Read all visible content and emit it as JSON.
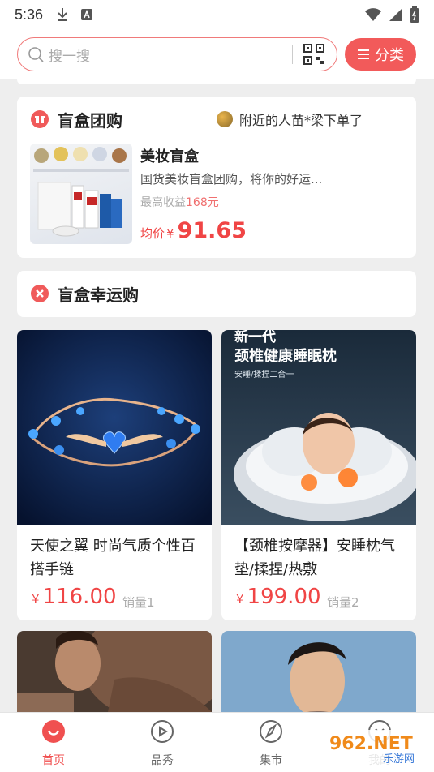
{
  "status_bar": {
    "time": "5:36"
  },
  "search": {
    "placeholder": "搜一搜"
  },
  "category_button": {
    "label": "分类"
  },
  "group_buy": {
    "title": "盲盒团购",
    "notice": "附近的人苗*梁下单了",
    "product": {
      "name": "美妆盲盒",
      "description": "国货美妆盲盒团购，将你的好运...",
      "max_earning_label": "最高收益",
      "max_earning_value": "168元",
      "avg_label": "均价",
      "currency": "¥",
      "avg_price": "91.65"
    }
  },
  "lucky_buy": {
    "title": "盲盒幸运购"
  },
  "products": [
    {
      "title": "天使之翼 时尚气质个性百搭手链",
      "currency": "¥",
      "price": "116.00",
      "sales": "销量1"
    },
    {
      "title": "【颈椎按摩器】安睡枕气垫/揉捏/热敷",
      "image_headline": "新一代",
      "image_subheadline": "颈椎健康睡眠枕",
      "image_caption": "安睡/揉捏二合一",
      "currency": "¥",
      "price": "199.00",
      "sales": "销量2"
    }
  ],
  "tab_bar": [
    {
      "label": "首页",
      "icon": "home-icon",
      "active": true
    },
    {
      "label": "品秀",
      "icon": "play-icon",
      "active": false
    },
    {
      "label": "集市",
      "icon": "compass-icon",
      "active": false
    },
    {
      "label": "我的",
      "icon": "user-icon",
      "active": false
    }
  ],
  "watermark": {
    "brand": "962.NET",
    "sub": "乐游网"
  },
  "colors": {
    "accent": "#f05a5a",
    "price": "#f04545",
    "background": "#eeeeee"
  }
}
